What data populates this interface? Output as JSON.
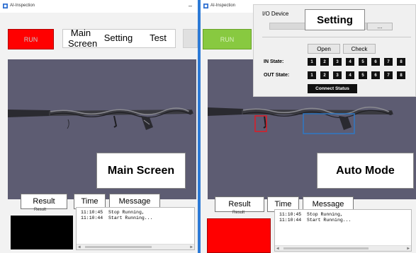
{
  "colors": {
    "run_left": "#ff0000",
    "run_left_text": "#c8c8c8",
    "run_right": "#88c940",
    "run_right_text": "#d9f0c0",
    "camera_bg": "#5d5c72",
    "result_left": "#000000",
    "result_right": "#ff0000",
    "defect_red": "#e01b24",
    "defect_blue": "#2f78c4"
  },
  "left_window": {
    "title": "AI-Inspection",
    "minimize": "–",
    "run_label": "RUN",
    "tabs": [
      "Main Screen",
      "Setting",
      "Test"
    ],
    "callout": "Main Screen",
    "labels": {
      "result": "Result",
      "time": "Time",
      "message": "Message"
    },
    "result_caption": "Result",
    "messages": [
      {
        "time": "11:10:45",
        "text": "Stop Running,"
      },
      {
        "time": "11:10:44",
        "text": "Start Running..."
      }
    ]
  },
  "right_window": {
    "title": "AI-Inspection",
    "run_label": "RUN",
    "callout": "Auto Mode",
    "labels": {
      "result": "Result",
      "time": "Time",
      "message": "Message"
    },
    "result_caption": "Result",
    "messages": [
      {
        "time": "11:10:45",
        "text": "Stop Running,"
      },
      {
        "time": "11:10:44",
        "text": "Start Running..."
      }
    ]
  },
  "io_panel": {
    "group_label": "I/O Device",
    "setting_callout": "Setting",
    "browse_label": "...",
    "open_label": "Open",
    "check_label": "Check",
    "in_state_label": "IN State:",
    "out_state_label": "OUT State:",
    "pins": [
      "1",
      "2",
      "3",
      "4",
      "5",
      "6",
      "7",
      "8"
    ],
    "connect_label": "Connect Status"
  },
  "icons": [
    "app-logo-icon",
    "minimize-icon",
    "scroll-left-icon",
    "scroll-right-icon"
  ]
}
